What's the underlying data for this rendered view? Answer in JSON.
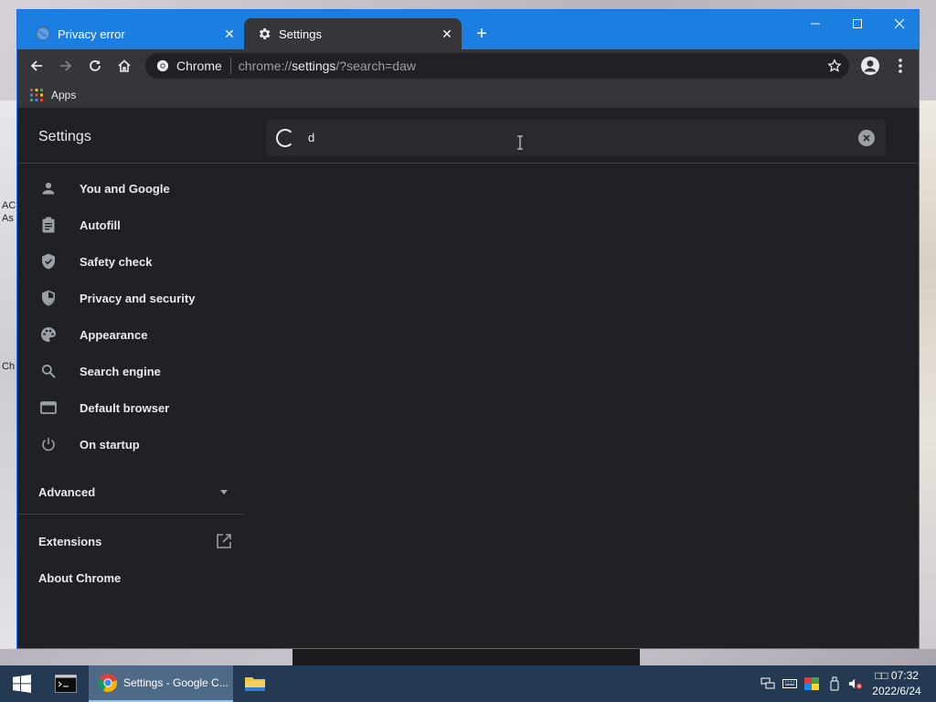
{
  "tabs": [
    {
      "title": "Privacy error",
      "active": false
    },
    {
      "title": "Settings",
      "active": true
    }
  ],
  "omnibox": {
    "chip_label": "Chrome",
    "url_prefix": "chrome://",
    "url_host": "settings",
    "url_suffix": "/?search=daw"
  },
  "bookmarks": {
    "apps_label": "Apps"
  },
  "settings": {
    "title": "Settings",
    "search_value": "d",
    "nav_items": [
      {
        "label": "You and Google",
        "icon": "person-icon"
      },
      {
        "label": "Autofill",
        "icon": "clipboard-icon"
      },
      {
        "label": "Safety check",
        "icon": "shield-check-icon"
      },
      {
        "label": "Privacy and security",
        "icon": "shield-icon"
      },
      {
        "label": "Appearance",
        "icon": "palette-icon"
      },
      {
        "label": "Search engine",
        "icon": "search-icon"
      },
      {
        "label": "Default browser",
        "icon": "browser-icon"
      },
      {
        "label": "On startup",
        "icon": "power-icon"
      }
    ],
    "advanced_label": "Advanced",
    "extensions_label": "Extensions",
    "about_label": "About Chrome"
  },
  "taskbar": {
    "chrome_task_label": "Settings - Google C...",
    "clock_time": "□□ 07:32",
    "clock_date": "2022/6/24"
  },
  "desktop_fragments": {
    "frag_ac": "AC",
    "frag_as": "As",
    "frag_ch": "Ch"
  },
  "colors": {
    "accent": "#1a7fe0",
    "page_bg": "#202124",
    "toolbar_bg": "#35363a",
    "text": "#e8eaed",
    "taskbar": "#243a52"
  }
}
